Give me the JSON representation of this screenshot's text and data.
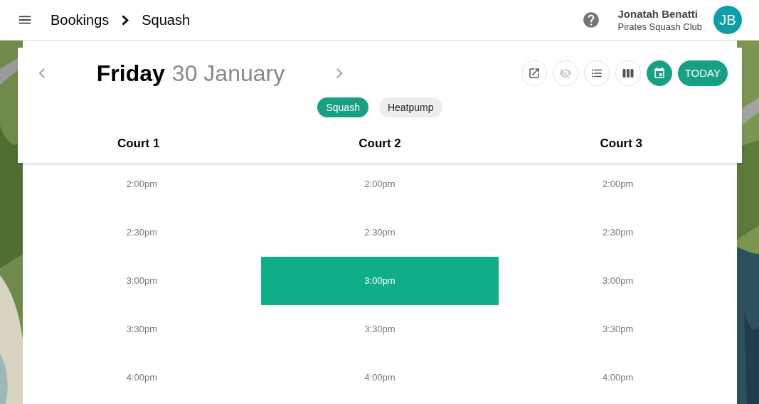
{
  "header": {
    "breadcrumbs": [
      "Bookings",
      "Squash"
    ],
    "user": {
      "name": "Jonatah Benatti",
      "club": "Pirates Squash Club",
      "initials": "JB"
    }
  },
  "date": {
    "weekday": "Friday",
    "day": "30 January"
  },
  "toolbar": [
    {
      "kind": "open",
      "selected": false,
      "disabled": false
    },
    {
      "kind": "hide",
      "selected": false,
      "disabled": true
    },
    {
      "kind": "list",
      "selected": false,
      "disabled": false
    },
    {
      "kind": "columns",
      "selected": false,
      "disabled": false
    },
    {
      "kind": "calendar",
      "selected": true,
      "disabled": false
    }
  ],
  "today_button": "TODAY",
  "filters": [
    {
      "label": "Squash",
      "selected": true
    },
    {
      "label": "Heatpump",
      "selected": false
    }
  ],
  "courts": [
    "Court 1",
    "Court 2",
    "Court 3"
  ],
  "rows": [
    {
      "cells": [
        {
          "time": "2:00pm",
          "selected": false
        },
        {
          "time": "2:00pm",
          "selected": false
        },
        {
          "time": "2:00pm",
          "selected": false
        }
      ]
    },
    {
      "cells": [
        {
          "time": "2:30pm",
          "selected": false
        },
        {
          "time": "2:30pm",
          "selected": false
        },
        {
          "time": "2:30pm",
          "selected": false
        }
      ]
    },
    {
      "cells": [
        {
          "time": "3:00pm",
          "selected": false
        },
        {
          "time": "3:00pm",
          "selected": true
        },
        {
          "time": "3:00pm",
          "selected": false
        }
      ]
    },
    {
      "cells": [
        {
          "time": "3:30pm",
          "selected": false
        },
        {
          "time": "3:30pm",
          "selected": false
        },
        {
          "time": "3:30pm",
          "selected": false
        }
      ]
    },
    {
      "cells": [
        {
          "time": "4:00pm",
          "selected": false
        },
        {
          "time": "4:00pm",
          "selected": false
        },
        {
          "time": "4:00pm",
          "selected": false
        }
      ]
    }
  ]
}
